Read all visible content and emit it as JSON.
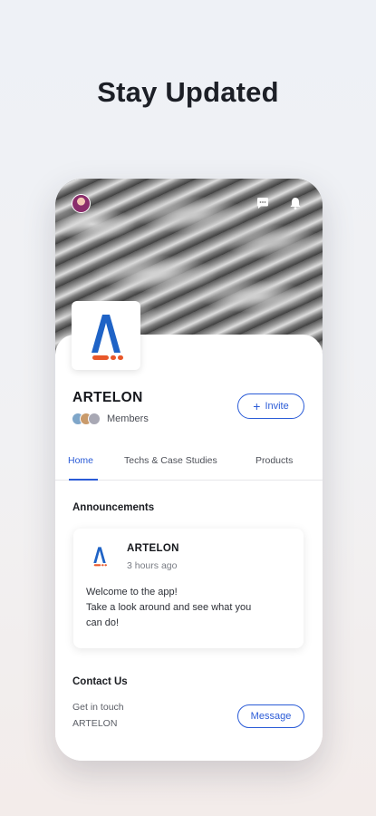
{
  "headline": "Stay Updated",
  "org": {
    "name": "ARTELON",
    "members_label": "Members",
    "invite_label": "Invite",
    "invite_icon": "+"
  },
  "tabs": [
    {
      "label": "Home",
      "active": true
    },
    {
      "label": "Techs & Case Studies",
      "active": false
    },
    {
      "label": "Products",
      "active": false
    }
  ],
  "announcements": {
    "title": "Announcements",
    "post": {
      "author": "ARTELON",
      "time": "3 hours ago",
      "body_lines": [
        "Welcome to the app!",
        "Take a look around and see what you",
        "can do!"
      ]
    }
  },
  "contact": {
    "title": "Contact Us",
    "line1": "Get in touch",
    "line2": "ARTELON",
    "button_label": "Message"
  },
  "icons": {
    "cover_left": "profile-avatar",
    "cover_right": [
      "chat-icon",
      "bell-icon"
    ]
  },
  "colors": {
    "accent": "#2a5bd7",
    "logo_blue": "#1f63c6",
    "logo_orange": "#e8572a"
  }
}
